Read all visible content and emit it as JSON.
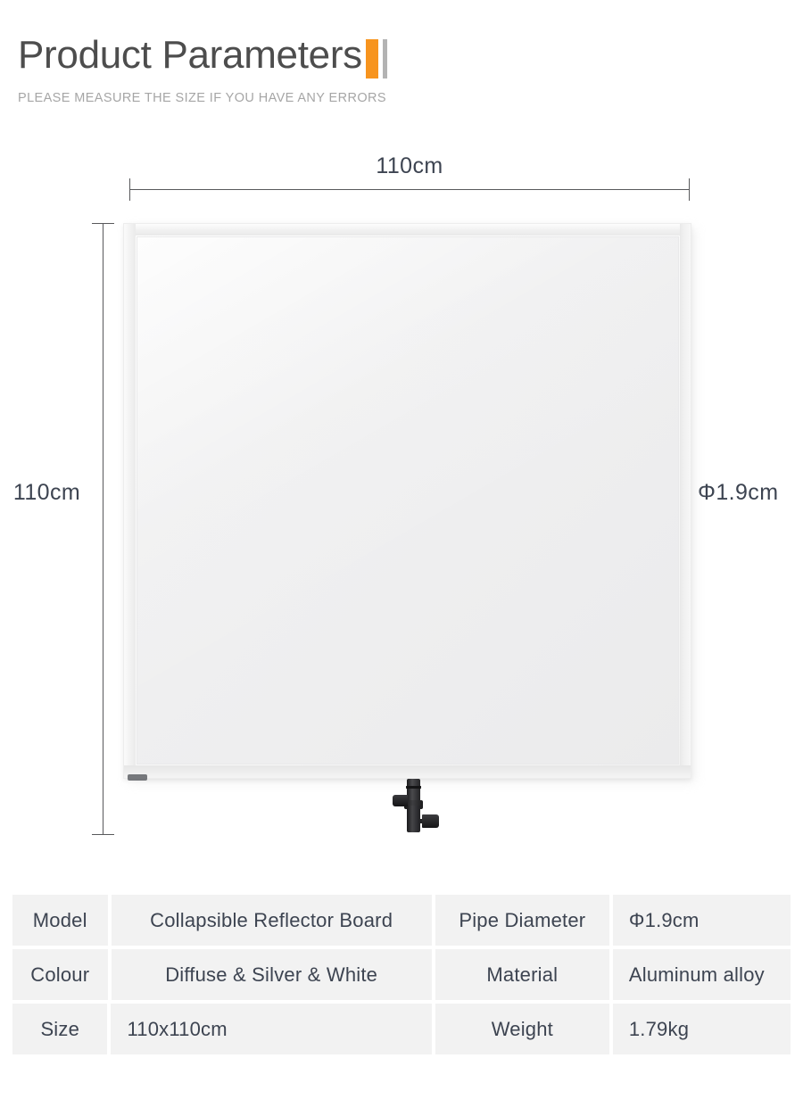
{
  "header": {
    "title": "Product Parameters",
    "subtitle": "PLEASE MEASURE THE SIZE IF YOU HAVE ANY ERRORS",
    "accent_color": "#f7941e",
    "accent_secondary_color": "#b3b3b3"
  },
  "diagram": {
    "width_label": "110cm",
    "height_label": "110cm",
    "pipe_diameter_label": "Φ1.9cm",
    "product_depicted": "collapsible reflector board with mounting bracket"
  },
  "specs": {
    "rows": [
      {
        "label_a": "Model",
        "value_a": "Collapsible Reflector Board",
        "label_b": "Pipe Diameter",
        "value_b": "Φ1.9cm",
        "value_a_align": "center",
        "value_b_align": "left"
      },
      {
        "label_a": "Colour",
        "value_a": "Diffuse & Silver & White",
        "label_b": "Material",
        "value_b": "Aluminum alloy",
        "value_a_align": "center",
        "value_b_align": "left"
      },
      {
        "label_a": "Size",
        "value_a": "110x110cm",
        "label_b": "Weight",
        "value_b": "1.79kg",
        "value_a_align": "left",
        "value_b_align": "left"
      }
    ]
  }
}
